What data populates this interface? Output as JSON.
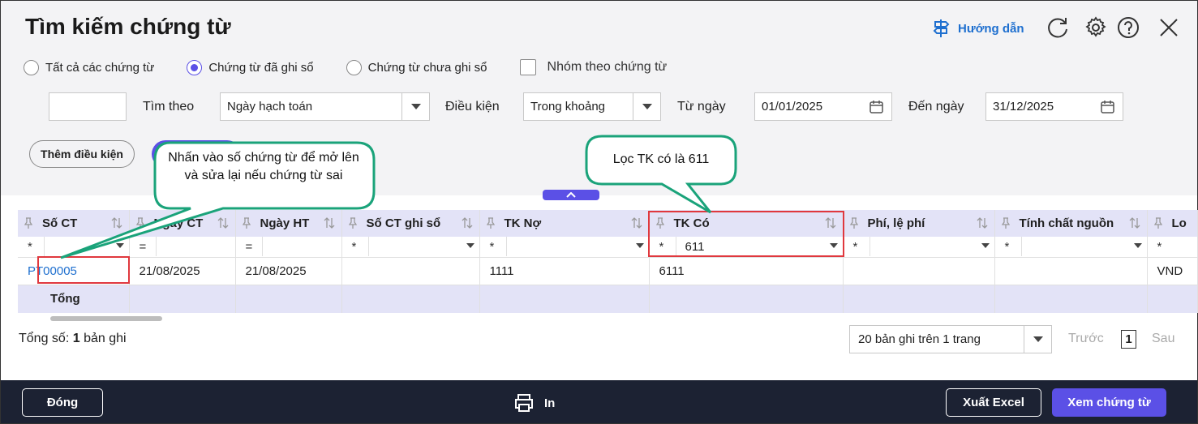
{
  "dialog": {
    "title": "Tìm kiếm chứng từ",
    "guide_label": "Hướng dẫn"
  },
  "icons": {
    "guide": "signpost-icon",
    "refresh": "refresh-icon",
    "settings": "gear-icon",
    "help": "help-icon",
    "close": "close-icon"
  },
  "filters": {
    "radios": [
      {
        "label": "Tất cả các chứng từ",
        "checked": false
      },
      {
        "label": "Chứng từ đã ghi sổ",
        "checked": true
      },
      {
        "label": "Chứng từ chưa ghi sổ",
        "checked": false
      }
    ],
    "group_checkbox": "Nhóm theo chứng từ",
    "search_by_label": "Tìm theo",
    "search_by_value": "Ngày hạch toán",
    "condition_label": "Điều kiện",
    "condition_value": "Trong khoảng",
    "from_label": "Từ ngày",
    "from_value": "01/01/2025",
    "to_label": "Đến ngày",
    "to_value": "31/12/2025",
    "add_condition": "Thêm điều kiện"
  },
  "grid": {
    "columns": [
      "Số CT",
      "Ngày CT",
      "Ngày HT",
      "Số CT ghi sổ",
      "TK Nợ",
      "TK Có",
      "Phí, lệ phí",
      "Tính chất nguồn",
      "Lo"
    ],
    "filter_ops": [
      "*",
      "=",
      "=",
      "*",
      "*",
      "*",
      "*",
      "*",
      "*"
    ],
    "filter_tk_co_value": "611",
    "rows": [
      {
        "so_ct": "PT00005",
        "ngay_ct": "21/08/2025",
        "ngay_ht": "21/08/2025",
        "so_ct_ghi_so": "",
        "tk_no": "1111",
        "tk_co": "6111",
        "phi": "",
        "tinh_chat": "",
        "lo": "VND"
      }
    ],
    "total_label": "Tổng"
  },
  "pager": {
    "count_prefix": "Tổng số:",
    "count_value": "1",
    "count_suffix": "bản ghi",
    "page_size": "20 bản ghi trên 1 trang",
    "prev": "Trước",
    "page": "1",
    "next": "Sau"
  },
  "footer": {
    "close": "Đóng",
    "print": "In",
    "export": "Xuất Excel",
    "view": "Xem chứng từ"
  },
  "callouts": {
    "left": "Nhấn vào số chứng từ để mở lên và sửa lại nếu chứng từ sai",
    "right": "Lọc TK có là 611"
  },
  "colors": {
    "accent": "#5b50e6",
    "link": "#1e6fcf",
    "callout_border": "#1aa37a",
    "highlight": "#e0383e",
    "footer": "#1c2233"
  }
}
